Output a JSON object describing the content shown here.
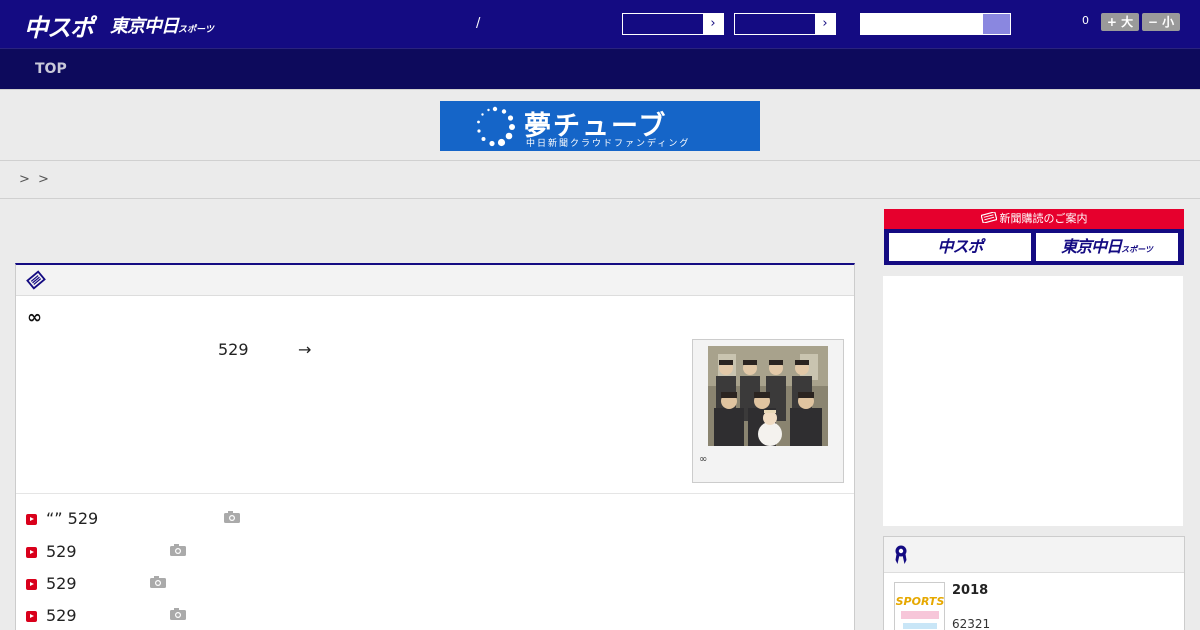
{
  "header": {
    "logo_main": "中スポ",
    "logo_tokyo": "東京中日",
    "logo_tokyo_small": "スポーツ",
    "separator": "/",
    "select_arrow_1": "›",
    "select_arrow_2": "›",
    "search_placeholder": "",
    "font_size_count": "0",
    "font_larger_label": "+ 大",
    "font_smaller_label": "− 小",
    "bg_color": "#140b82"
  },
  "nav": {
    "items": [
      {
        "label": "TOP"
      }
    ]
  },
  "banner": {
    "title": "夢チューブ",
    "subtitle": "中日新聞クラウドファンディング"
  },
  "breadcrumb": {
    "separators": [
      ">",
      ">"
    ]
  },
  "article": {
    "title": "∞",
    "number": "529",
    "arrow": "→",
    "photo_caption": "∞",
    "related": [
      {
        "text": "“” 529"
      },
      {
        "text": " 529"
      },
      {
        "text": " 529"
      },
      {
        "text": " 529"
      }
    ]
  },
  "sidebar": {
    "subscribe_header": "新聞購読のご案内",
    "subscribe_chuspo": "中スポ",
    "subscribe_tokyo": "東京中日",
    "subscribe_tokyo_small": "スポーツ",
    "ranking": {
      "title": "2018",
      "number": "62321"
    }
  },
  "colors": {
    "accent_red": "#e6002d",
    "nav_bg": "#0d0a5c",
    "banner_blue": "#1565c8"
  }
}
